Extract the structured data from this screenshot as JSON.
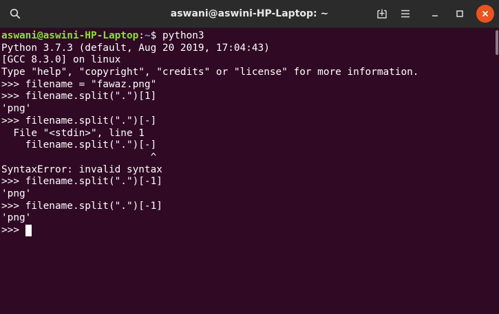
{
  "titlebar": {
    "title": "aswani@aswini-HP-Laptop: ~",
    "icons": {
      "search": "search-icon",
      "new_tab": "new-tab-icon",
      "menu": "hamburger-menu-icon",
      "minimize": "minimize-icon",
      "maximize": "maximize-icon",
      "close": "close-icon"
    }
  },
  "colors": {
    "terminal_background": "#300a24",
    "prompt_user": "#8ae234",
    "prompt_path": "#729fcf",
    "close_button": "#e95420",
    "text": "#ffffff"
  },
  "terminal": {
    "prompt": {
      "user_host": "aswani@aswini-HP-Laptop",
      "separator": ":",
      "path": "~",
      "symbol": "$ ",
      "command": "python3"
    },
    "lines": [
      "Python 3.7.3 (default, Aug 20 2019, 17:04:43)",
      "[GCC 8.3.0] on linux",
      "Type \"help\", \"copyright\", \"credits\" or \"license\" for more information.",
      ">>> filename = \"fawaz.png\"",
      ">>> filename.split(\".\")[1]",
      "'png'",
      ">>> filename.split(\".\")[-]",
      "  File \"<stdin>\", line 1",
      "    filename.split(\".\")[-]",
      "                         ^",
      "SyntaxError: invalid syntax",
      ">>> filename.split(\".\")[-1]",
      "'png'",
      ">>> filename.split(\".\")[-1]",
      "'png'"
    ],
    "current_prompt": ">>> "
  }
}
